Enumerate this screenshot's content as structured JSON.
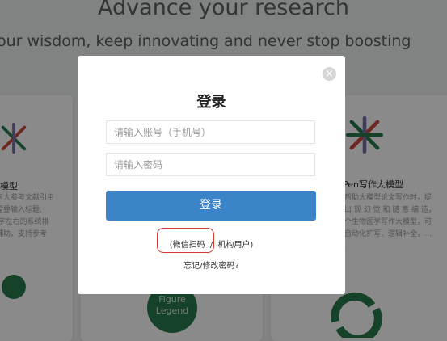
{
  "background": {
    "hero_title": "Advance your research",
    "hero_subtitle": "our wisdom, keep innovating and never stop boosting",
    "left_card": {
      "title": "模型",
      "desc": [
        "以南大参考文献引用",
        "只需要输入标题,",
        "00字左右的系统排",
        "，辅助，支持参考"
      ]
    },
    "right_card": {
      "title": "Pen写作大模型",
      "desc": [
        "帮助大模型论文写作时，提",
        "出 现 幻 觉 和 随 意 编 造，",
        "个生物医学写作大模型，可",
        "自动化扩写，逻辑补全，…"
      ]
    },
    "mid_card_label": "Figure Legend"
  },
  "modal": {
    "title": "登录",
    "account_placeholder": "请输入账号（手机号）",
    "password_placeholder": "请输入密码",
    "login_button": "登录",
    "wechat_link": "(微信扫码",
    "separator": "/",
    "institution_link": "机构用户)",
    "forgot_link": "忘记/修改密码?",
    "close_symbol": "×"
  },
  "colors": {
    "primary": "#3b84c8",
    "highlight": "#d53a34",
    "logo_green": "#2a7b4f",
    "logo_red": "#c9463d"
  }
}
